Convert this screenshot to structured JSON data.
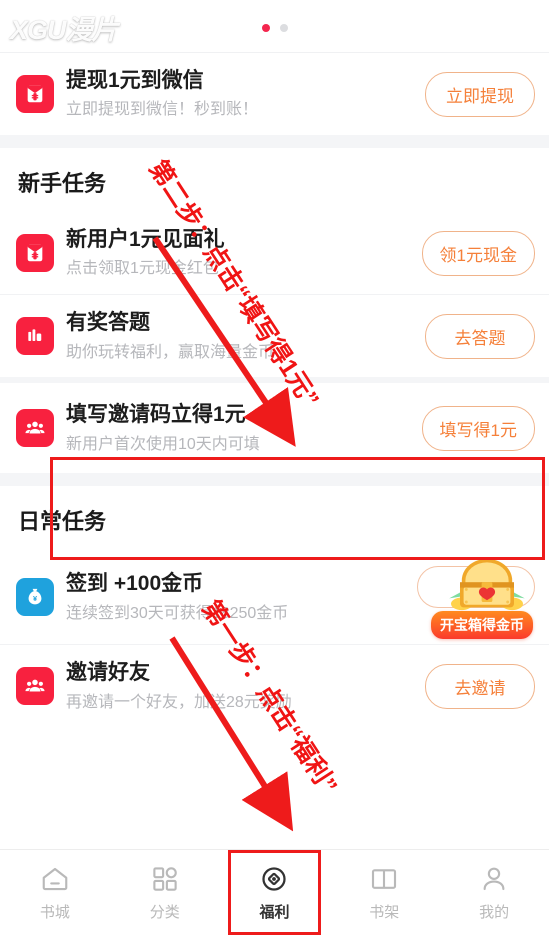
{
  "app": {
    "watermark": "XGU漫片",
    "brand_red": "#f8213f",
    "accent_orange": "#f5803a",
    "annotation_red": "#ee1b1b",
    "page_bg": "#f4f5f7"
  },
  "banner": {
    "dots": [
      {
        "name": "dot-1",
        "active": true
      },
      {
        "name": "dot-2",
        "active": false
      }
    ]
  },
  "withdraw_card": {
    "icon": "red-packet-icon",
    "title": "提现1元到微信",
    "subtitle": "立即提现到微信！秒到账！",
    "button": "立即提现"
  },
  "novice": {
    "heading": "新手任务",
    "items": [
      {
        "icon": "red-packet-icon",
        "title": "新用户1元见面礼",
        "subtitle": "点击领取1元现金红包",
        "button": "领1元现金",
        "highlighted": false
      },
      {
        "icon": "chart-books-icon",
        "title": "有奖答题",
        "subtitle": "助你玩转福利，赢取海量金币",
        "button": "去答题",
        "highlighted": false
      },
      {
        "icon": "group-people-icon",
        "title": "填写邀请码立得1元",
        "subtitle": "新用户首次使用10天内可填",
        "button": "填写得1元",
        "highlighted": true
      }
    ]
  },
  "daily": {
    "heading": "日常任务",
    "items": [
      {
        "icon": "money-bag-icon",
        "title": "签到 +100金币",
        "subtitle": "连续签到30天可获得18250金币",
        "chest_label": "开宝箱得金币",
        "has_chest": true
      },
      {
        "icon": "group-people-icon",
        "title": "邀请好友",
        "subtitle": "再邀请一个好友，加送28元奖励",
        "button": "去邀请",
        "has_chest": false
      }
    ]
  },
  "annotations": [
    {
      "name": "annotation-step-two",
      "text": "第二步：点击“填写得1元”",
      "color": "#f01414"
    },
    {
      "name": "annotation-step-one",
      "text": "第一步：点击“福利”",
      "color": "#f01414"
    }
  ],
  "tabbar": {
    "tabs": [
      {
        "icon": "home-icon",
        "label": "书城",
        "active": false
      },
      {
        "icon": "grid-icon",
        "label": "分类",
        "active": false
      },
      {
        "icon": "coin-icon",
        "label": "福利",
        "active": true
      },
      {
        "icon": "book-open-icon",
        "label": "书架",
        "active": false
      },
      {
        "icon": "person-icon",
        "label": "我的",
        "active": false
      }
    ]
  }
}
